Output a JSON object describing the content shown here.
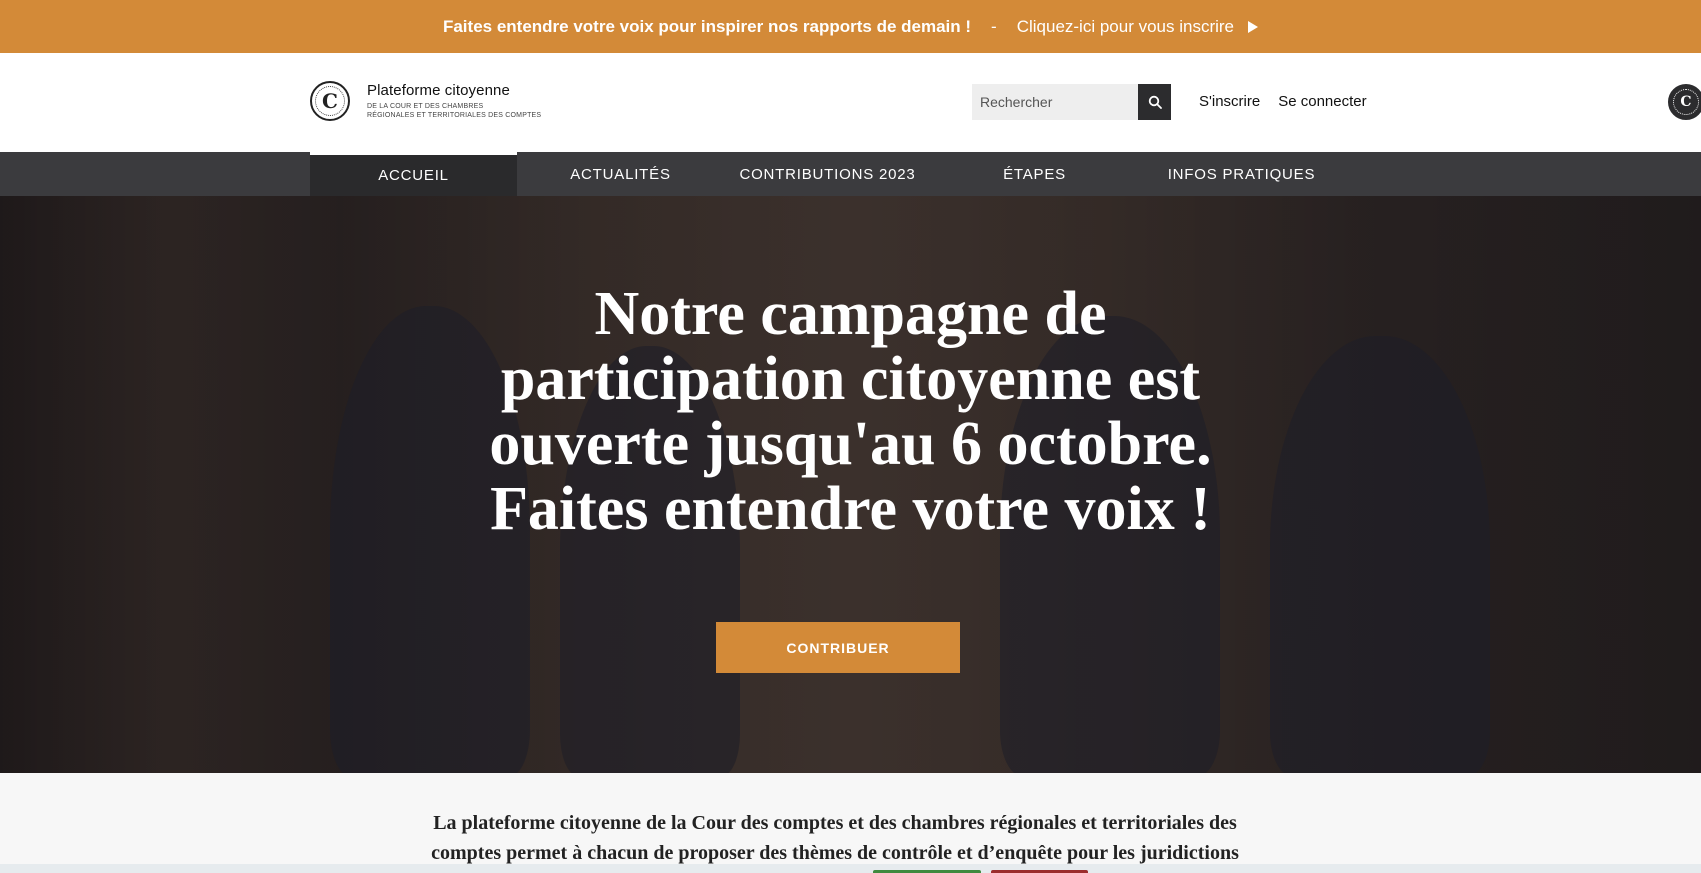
{
  "top_banner": {
    "message": "Faites entendre votre voix pour inspirer nos rapports de demain !",
    "separator": "-",
    "cta": "Cliquez-ici pour vous inscrire",
    "cta_icon": "play-triangle-icon",
    "background": "#d38a38"
  },
  "header": {
    "logo_title": "Plateforme citoyenne",
    "logo_sub_line1": "DE LA COUR ET DES CHAMBRES",
    "logo_sub_line2": "RÉGIONALES ET TERRITORIALES DES COMPTES",
    "logo_icon": "court-seal-icon",
    "search": {
      "placeholder": "Rechercher",
      "value": "",
      "icon": "search-icon"
    },
    "signup": "S'inscrire",
    "login": "Se connecter"
  },
  "nav": {
    "items": [
      {
        "label": "ACCUEIL",
        "active": true
      },
      {
        "label": "ACTUALITÉS",
        "active": false
      },
      {
        "label": "CONTRIBUTIONS 2023",
        "active": false
      },
      {
        "label": "ÉTAPES",
        "active": false
      },
      {
        "label": "INFOS PRATIQUES",
        "active": false
      }
    ]
  },
  "hero": {
    "title": "Notre campagne de participation citoyenne est ouverte jusqu'au 6 octobre. Faites entendre votre voix !",
    "button": "CONTRIBUER"
  },
  "intro": {
    "line1": "La plateforme citoyenne de la Cour des comptes et des chambres régionales et territoriales des",
    "line2": "comptes permet à chacun de proposer des thèmes de contrôle et d’enquête pour les juridictions"
  },
  "colors": {
    "accent": "#d38a38",
    "nav_bg": "#3b3b3e",
    "nav_active_bg": "#2a2a2c"
  }
}
